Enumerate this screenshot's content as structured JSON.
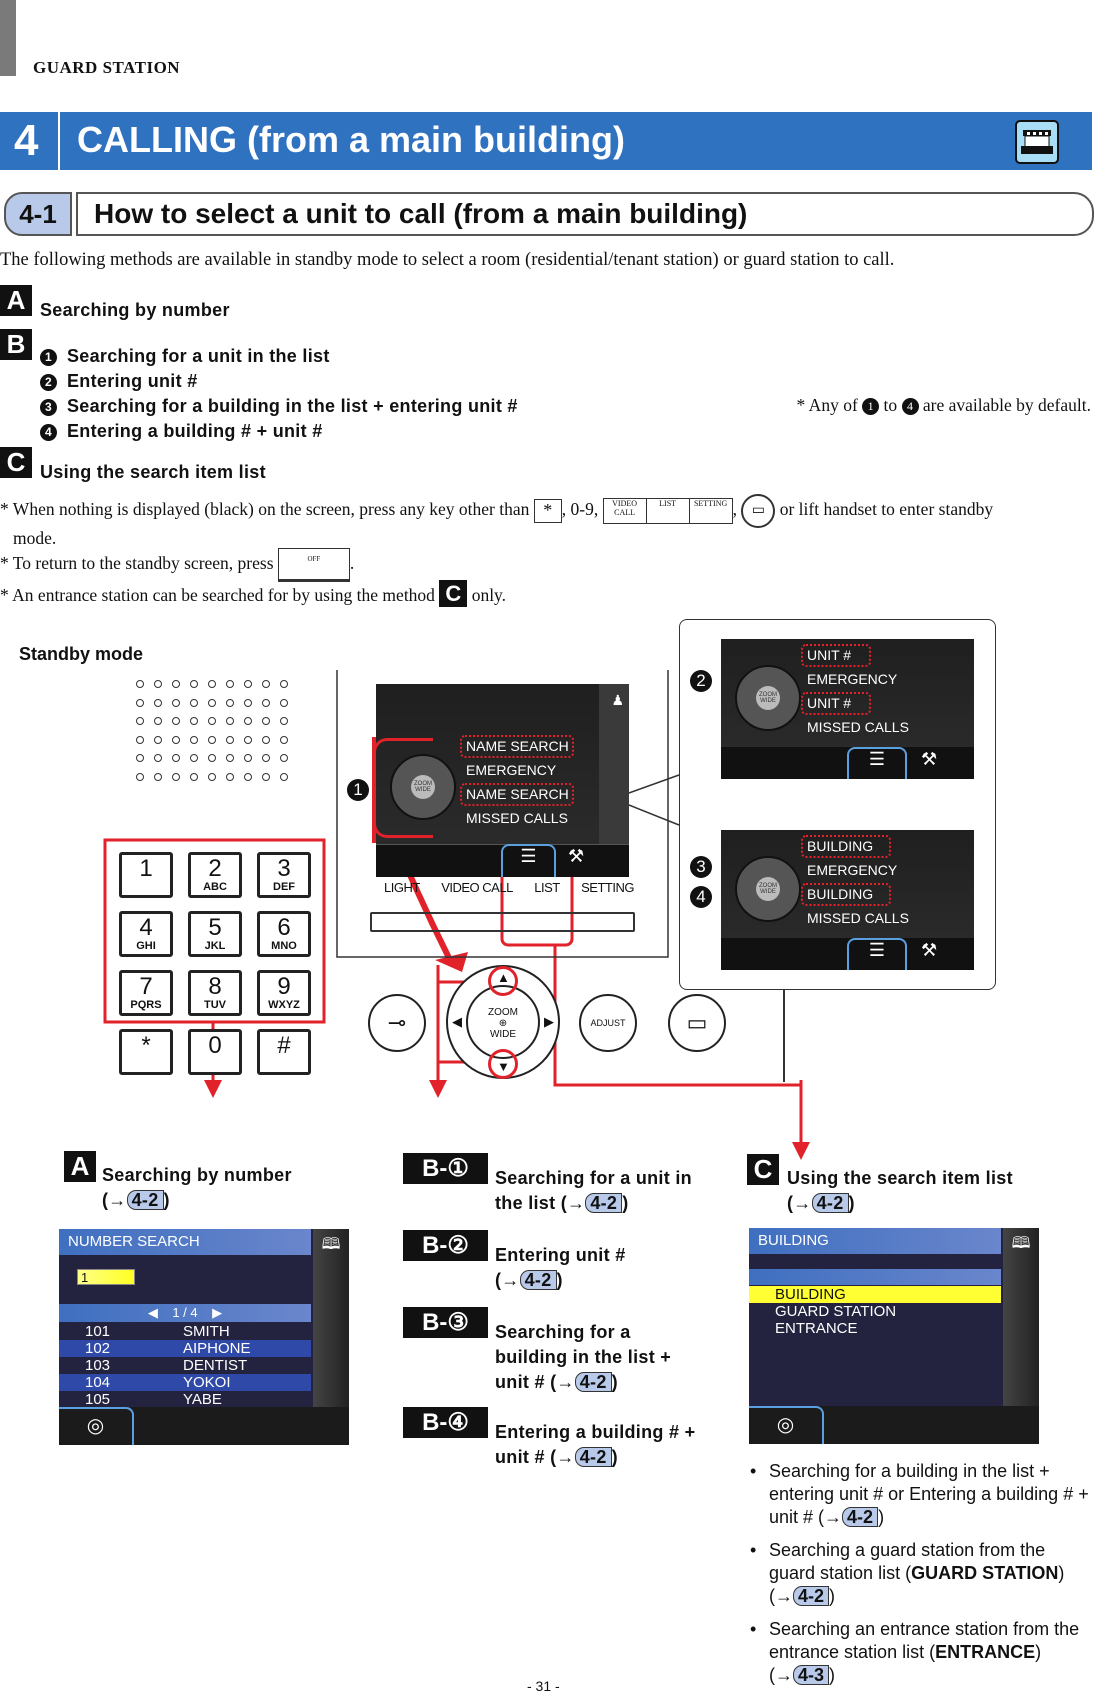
{
  "header": {
    "running_title": "GUARD STATION"
  },
  "chapter": {
    "number": "4",
    "title": "CALLING (from a main building)",
    "icon": "building-icon"
  },
  "section": {
    "number": "4-1",
    "title": "How to select a unit to call (from a main building)"
  },
  "intro": "The following methods are available in standby mode to select a room (residential/tenant station) or guard station to call.",
  "methods": {
    "a": {
      "label": "A",
      "text": "Searching by number"
    },
    "b": {
      "label": "B",
      "items": [
        {
          "num": "1",
          "text": "Searching for a unit in the list"
        },
        {
          "num": "2",
          "text": "Entering unit #"
        },
        {
          "num": "3",
          "text": "Searching for a building in the list + entering unit #"
        },
        {
          "num": "4",
          "text": "Entering a building # + unit #"
        }
      ],
      "note_prefix": "* Any of",
      "note_from": "1",
      "note_to_word": "to",
      "note_to": "4",
      "note_suffix": "are available by default."
    },
    "c": {
      "label": "C",
      "text": "Using the search item list"
    }
  },
  "notes": {
    "n1_a": "* When nothing is displayed (black) on the screen, press any key other than",
    "n1_star": "*",
    "n1_b": ", 0-9,",
    "n1_keys": [
      "VIDEO CALL",
      "LIST",
      "SETTING"
    ],
    "n1_c": "or lift handset to enter standby",
    "n1_d": "mode.",
    "n2": "* To return to the standby screen, press",
    "n2_key": "OFF",
    "n3_a": "* An entrance station can be searched for by using the method",
    "n3_label": "C",
    "n3_b": "only."
  },
  "diagram": {
    "standby_label": "Standby mode",
    "keypad": [
      {
        "d": "1",
        "s": ""
      },
      {
        "d": "2",
        "s": "ABC"
      },
      {
        "d": "3",
        "s": "DEF"
      },
      {
        "d": "4",
        "s": "GHI"
      },
      {
        "d": "5",
        "s": "JKL"
      },
      {
        "d": "6",
        "s": "MNO"
      },
      {
        "d": "7",
        "s": "PQRS"
      },
      {
        "d": "8",
        "s": "TUV"
      },
      {
        "d": "9",
        "s": "WXYZ"
      },
      {
        "d": "*",
        "s": ""
      },
      {
        "d": "0",
        "s": ""
      },
      {
        "d": "#",
        "s": ""
      }
    ],
    "screen1": {
      "items": [
        "NAME SEARCH",
        "EMERGENCY",
        "NAME SEARCH",
        "MISSED CALLS"
      ],
      "marker": "1"
    },
    "screen2": {
      "items": [
        "UNIT #",
        "EMERGENCY",
        "UNIT #",
        "MISSED CALLS"
      ],
      "marker": "2"
    },
    "screen3": {
      "items": [
        "BUILDING",
        "EMERGENCY",
        "BUILDING",
        "MISSED CALLS"
      ],
      "markers": [
        "3",
        "4"
      ]
    },
    "pad_zoom": "ZOOM",
    "pad_wide": "WIDE",
    "panel_buttons": [
      "LIGHT",
      "VIDEO CALL",
      "LIST",
      "SETTING"
    ],
    "adjust": "ADJUST",
    "accent_red": "#e2222a",
    "accent_blue": "#2f72c0"
  },
  "result_a": {
    "label": "A",
    "text": "Searching by number",
    "ref": "4-2",
    "screen": {
      "title": "NUMBER SEARCH",
      "input": "1",
      "page": "1 / 4",
      "rows": [
        [
          "101",
          "SMITH"
        ],
        [
          "102",
          "AIPHONE"
        ],
        [
          "103",
          "DENTIST"
        ],
        [
          "104",
          "YOKOI"
        ],
        [
          "105",
          "YABE"
        ]
      ]
    }
  },
  "result_b": [
    {
      "label": "B-①",
      "text": "Searching for a unit in the list",
      "ref": "4-2"
    },
    {
      "label": "B-②",
      "text": "Entering unit #",
      "ref": "4-2"
    },
    {
      "label": "B-③",
      "text": "Searching for a building in the list + unit #",
      "ref": "4-2"
    },
    {
      "label": "B-④",
      "text": "Entering a building # + unit #",
      "ref": "4-2"
    }
  ],
  "result_c": {
    "label": "C",
    "text": "Using the search item list",
    "ref": "4-2",
    "screen": {
      "title": "BUILDING",
      "items": [
        "BUILDING",
        "GUARD STATION",
        "ENTRANCE"
      ]
    },
    "bullets": [
      {
        "text": "Searching for a building in the list + entering unit # or Entering a building # + unit #",
        "bold": "",
        "ref": "4-2"
      },
      {
        "text": "Searching a guard station from the guard station list (",
        "bold": "GUARD STATION",
        "ref": "4-2"
      },
      {
        "text": "Searching an entrance station from the entrance station list (",
        "bold": "ENTRANCE",
        "ref": "4-3"
      }
    ]
  },
  "footer": {
    "page": "- 31 -"
  }
}
